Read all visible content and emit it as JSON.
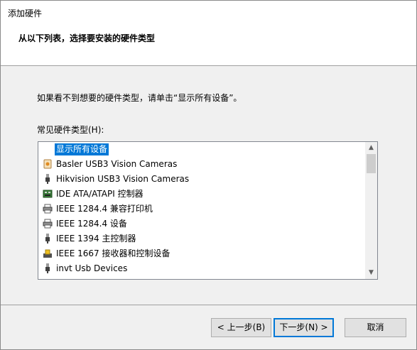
{
  "window": {
    "title": "添加硬件"
  },
  "header": {
    "title": "从以下列表，选择要安装的硬件类型"
  },
  "content": {
    "instruction": "如果看不到想要的硬件类型，请单击“显示所有设备”。",
    "list_label": "常见硬件类型(H):",
    "items": [
      {
        "label": "显示所有设备",
        "icon": "none",
        "selected": true
      },
      {
        "label": "Basler USB3 Vision Cameras",
        "icon": "device-icon"
      },
      {
        "label": "Hikvision USB3 Vision Cameras",
        "icon": "usb-icon"
      },
      {
        "label": "IDE ATA/ATAPI 控制器",
        "icon": "ide-controller-icon"
      },
      {
        "label": "IEEE 1284.4 兼容打印机",
        "icon": "printer-icon"
      },
      {
        "label": "IEEE 1284.4 设备",
        "icon": "printer-icon"
      },
      {
        "label": "IEEE 1394 主控制器",
        "icon": "usb-icon"
      },
      {
        "label": "IEEE 1667 接收器和控制设备",
        "icon": "card-reader-icon"
      },
      {
        "label": "invt Usb Devices",
        "icon": "usb-icon"
      }
    ]
  },
  "footer": {
    "back_label": "< 上一步(B)",
    "next_label": "下一步(N) >",
    "cancel_label": "取消"
  },
  "colors": {
    "selection": "#0078d7",
    "content_bg": "#f0f0f0",
    "button_bg": "#e1e1e1"
  }
}
